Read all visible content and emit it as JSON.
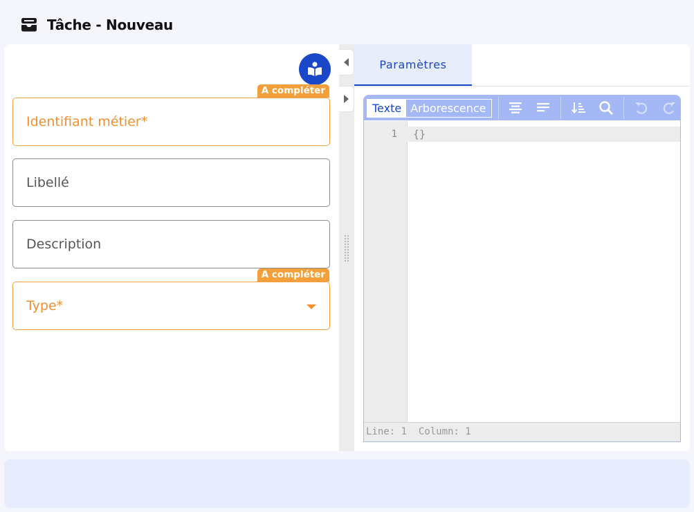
{
  "header": {
    "icon": "task-inbox-icon",
    "title": "Tâche - Nouveau"
  },
  "form": {
    "help_icon": "book-reader-icon",
    "fields": [
      {
        "label": "Identifiant métier*",
        "badge": "A compléter",
        "required": true
      },
      {
        "label": "Libellé"
      },
      {
        "label": "Description"
      },
      {
        "label": "Type*",
        "badge": "A compléter",
        "required": true,
        "kind": "select"
      }
    ]
  },
  "tabs": [
    {
      "label": "Paramètres",
      "active": true
    }
  ],
  "editor": {
    "modes": [
      {
        "label": "Texte",
        "active": true
      },
      {
        "label": "Arborescence",
        "active": false
      }
    ],
    "toolbar_icons": [
      "format-icon",
      "compact-icon",
      "sort-icon",
      "search-icon",
      "undo-icon",
      "redo-icon"
    ],
    "line_number": "1",
    "content": "{}",
    "status": "Line: 1  Column: 1"
  },
  "colors": {
    "accent": "#1a47c8",
    "warning": "#f3a03a",
    "toolbar": "#a4b8f5"
  }
}
